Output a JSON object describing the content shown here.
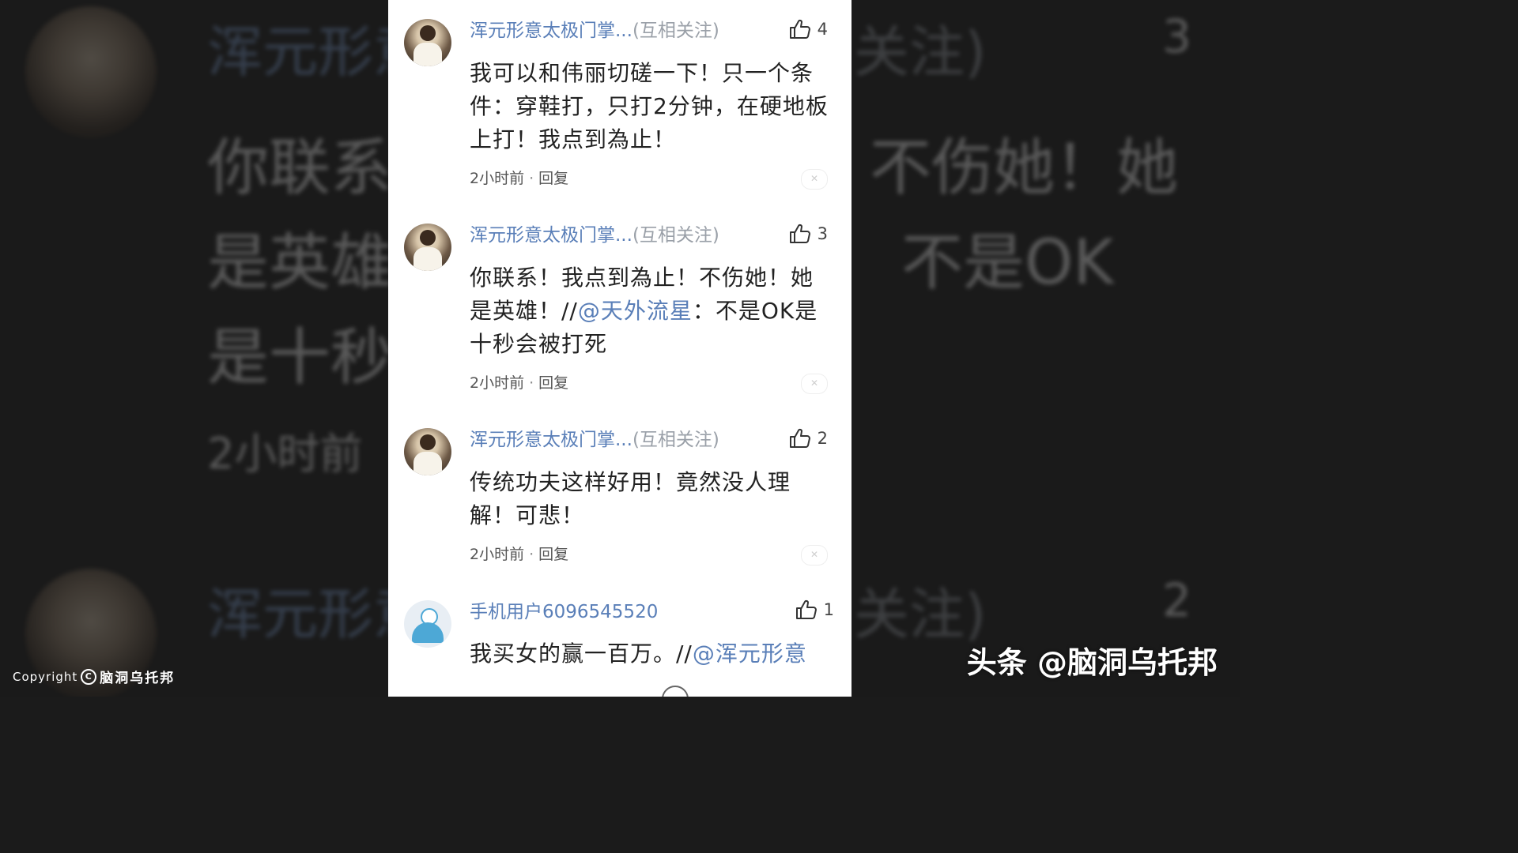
{
  "comments": [
    {
      "name": "浑元形意太极门掌...",
      "relation": "(互相关注)",
      "likes": "4",
      "text": "我可以和伟丽切磋一下！只一个条件：穿鞋打，只打2分钟，在硬地板上打！我点到為止！",
      "time": "2小时前",
      "reply": "回复"
    },
    {
      "name": "浑元形意太极门掌...",
      "relation": "(互相关注)",
      "likes": "3",
      "text_before": "你联系！我点到為止！不伤她！她是英雄！//",
      "mention": "@天外流星",
      "text_after": "：不是OK是十秒会被打死",
      "time": "2小时前",
      "reply": "回复"
    },
    {
      "name": "浑元形意太极门掌...",
      "relation": "(互相关注)",
      "likes": "2",
      "text": "传统功夫这样好用！竟然没人理解！可悲！",
      "time": "2小时前",
      "reply": "回复"
    },
    {
      "name": "手机用户6096545520",
      "likes": "1",
      "text_before": "我买女的赢一百万。//",
      "mention": "@浑元形意"
    }
  ],
  "background": {
    "name": "浑元形意",
    "follow_fragment": "关注)",
    "like_top": "3",
    "like_bottom": "2",
    "line1_left": "你联系",
    "line1_right": "不伤她！她",
    "line2_left": "是英雄",
    "line2_right": "不是OK",
    "line3_left": "是十秒",
    "time": "2小时前"
  },
  "watermark": {
    "copyright": "Copyright",
    "brand": "脑洞乌托邦",
    "right": "头条 @脑洞乌托邦"
  },
  "colors": {
    "link": "#5a7fb8",
    "muted": "#9aa0a8"
  },
  "icons": [
    "thumbs-up-icon",
    "close-icon",
    "copyright-icon"
  ]
}
